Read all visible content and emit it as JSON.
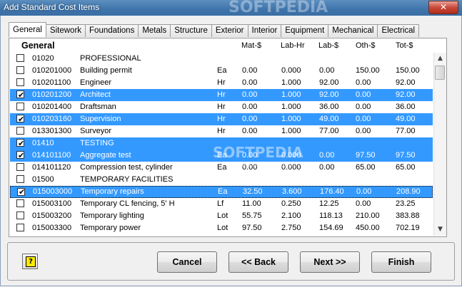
{
  "window": {
    "title": "Add Standard Cost Items",
    "close_glyph": "✕"
  },
  "tabs": [
    "General",
    "Sitework",
    "Foundations",
    "Metals",
    "Structure",
    "Exterior",
    "Interior",
    "Equipment",
    "Mechanical",
    "Electrical"
  ],
  "active_tab": "General",
  "section_title": "General",
  "columns": {
    "mat": "Mat-$",
    "labhr": "Lab-Hr",
    "lab": "Lab-$",
    "oth": "Oth-$",
    "tot": "Tot-$"
  },
  "rows": [
    {
      "checked": false,
      "selected": false,
      "code": "01020",
      "desc": "PROFESSIONAL",
      "unit": "",
      "mat": "",
      "labhr": "",
      "lab": "",
      "oth": "",
      "tot": ""
    },
    {
      "checked": false,
      "selected": false,
      "code": "010201000",
      "desc": "Building permit",
      "unit": "Ea",
      "mat": "0.00",
      "labhr": "0.000",
      "lab": "0.00",
      "oth": "150.00",
      "tot": "150.00"
    },
    {
      "checked": false,
      "selected": false,
      "code": "010201100",
      "desc": "Engineer",
      "unit": "Hr",
      "mat": "0.00",
      "labhr": "1.000",
      "lab": "92.00",
      "oth": "0.00",
      "tot": "92.00"
    },
    {
      "checked": true,
      "selected": true,
      "code": "010201200",
      "desc": "Architect",
      "unit": "Hr",
      "mat": "0.00",
      "labhr": "1.000",
      "lab": "92.00",
      "oth": "0.00",
      "tot": "92.00"
    },
    {
      "checked": false,
      "selected": false,
      "code": "010201400",
      "desc": "Draftsman",
      "unit": "Hr",
      "mat": "0.00",
      "labhr": "1.000",
      "lab": "36.00",
      "oth": "0.00",
      "tot": "36.00"
    },
    {
      "checked": true,
      "selected": true,
      "code": "010203160",
      "desc": "Supervision",
      "unit": "Hr",
      "mat": "0.00",
      "labhr": "1.000",
      "lab": "49.00",
      "oth": "0.00",
      "tot": "49.00"
    },
    {
      "checked": false,
      "selected": false,
      "code": "013301300",
      "desc": "Surveyor",
      "unit": "Hr",
      "mat": "0.00",
      "labhr": "1.000",
      "lab": "77.00",
      "oth": "0.00",
      "tot": "77.00"
    },
    {
      "checked": true,
      "selected": true,
      "code": "01410",
      "desc": "TESTING",
      "unit": "",
      "mat": "",
      "labhr": "",
      "lab": "",
      "oth": "",
      "tot": ""
    },
    {
      "checked": true,
      "selected": true,
      "code": "014101100",
      "desc": "Aggregate test",
      "unit": "Ea",
      "mat": "0.00",
      "labhr": "0.000",
      "lab": "0.00",
      "oth": "97.50",
      "tot": "97.50"
    },
    {
      "checked": false,
      "selected": false,
      "code": "014101120",
      "desc": "Compression test, cylinder",
      "unit": "Ea",
      "mat": "0.00",
      "labhr": "0.000",
      "lab": "0.00",
      "oth": "65.00",
      "tot": "65.00"
    },
    {
      "checked": false,
      "selected": false,
      "code": "01500",
      "desc": "TEMPORARY FACILITIES",
      "unit": "",
      "mat": "",
      "labhr": "",
      "lab": "",
      "oth": "",
      "tot": ""
    },
    {
      "checked": true,
      "selected": true,
      "focused": true,
      "code": "015003000",
      "desc": "Temporary repairs",
      "unit": "Ea",
      "mat": "32.50",
      "labhr": "3.600",
      "lab": "176.40",
      "oth": "0.00",
      "tot": "208.90"
    },
    {
      "checked": false,
      "selected": false,
      "code": "015003100",
      "desc": "Temporary CL fencing, 5' H",
      "unit": "Lf",
      "mat": "11.00",
      "labhr": "0.250",
      "lab": "12.25",
      "oth": "0.00",
      "tot": "23.25"
    },
    {
      "checked": false,
      "selected": false,
      "code": "015003200",
      "desc": "Temporary lighting",
      "unit": "Lot",
      "mat": "55.75",
      "labhr": "2.100",
      "lab": "118.13",
      "oth": "210.00",
      "tot": "383.88"
    },
    {
      "checked": false,
      "selected": false,
      "code": "015003300",
      "desc": "Temporary power",
      "unit": "Lot",
      "mat": "97.50",
      "labhr": "2.750",
      "lab": "154.69",
      "oth": "450.00",
      "tot": "702.19"
    }
  ],
  "buttons": {
    "help": "?",
    "cancel": "Cancel",
    "back": "<<  Back",
    "next": "Next  >>",
    "finish": "Finish"
  },
  "scrollbar": {
    "up": "▲",
    "down": "▼"
  },
  "watermarks": {
    "top": "SOFTPEDIA",
    "middle": "SOFTPEDIA",
    "middle_sub": "www.softpedia.com"
  },
  "colors": {
    "selection": "#3399ff",
    "titlebar": "#3f74ab",
    "close": "#c9493a"
  }
}
